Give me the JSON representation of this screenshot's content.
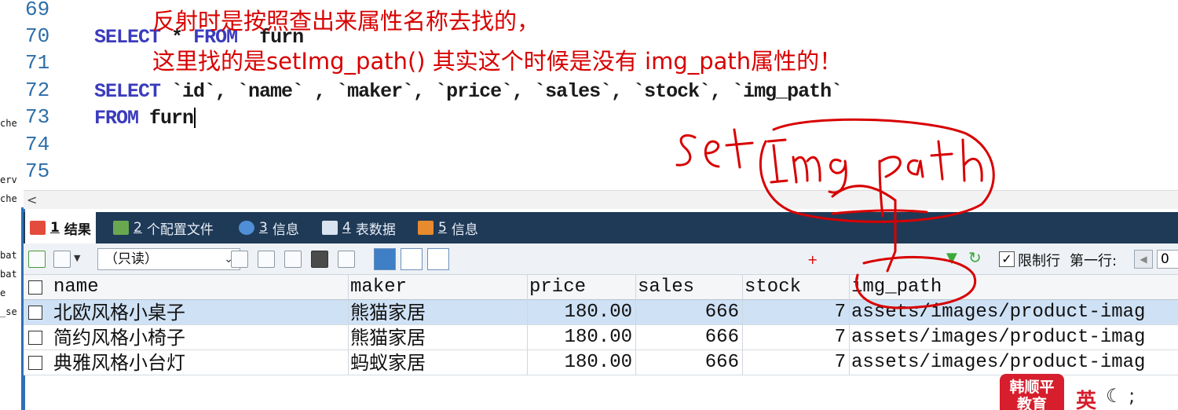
{
  "sidebar_fragments": [
    "che",
    "erv",
    "che",
    "bat",
    "bat",
    "e",
    "_se"
  ],
  "editor": {
    "line_numbers": [
      "69",
      "70",
      "71",
      "72",
      "73",
      "74",
      "75"
    ],
    "line70": {
      "kw1": "SELECT",
      "star": "*",
      "kw2": "FROM",
      "table": "furn"
    },
    "line72": {
      "kw": "SELECT",
      "cols": "`id`, `name` , `maker`, `price`, `sales`, `stock`, `img_path`"
    },
    "line73": {
      "kw": "FROM",
      "table": "furn"
    }
  },
  "annotation": {
    "line1": "反射时是按照查出来属性名称去找的，",
    "line2": "这里找的是setImg_path() 其实这个时候是没有 img_path属性的！",
    "handwriting": "setImg_path",
    "plus_mark": "+"
  },
  "hscroll": {
    "left_arrow": "<"
  },
  "tabs": [
    {
      "num": "1",
      "label": "结果",
      "active": true
    },
    {
      "num": "2",
      "label": "个配置文件",
      "active": false
    },
    {
      "num": "3",
      "label": "信息",
      "active": false
    },
    {
      "num": "4",
      "label": "表数据",
      "active": false
    },
    {
      "num": "5",
      "label": "信息",
      "active": false
    }
  ],
  "toolbar": {
    "readonly_option": "（只读）",
    "limit_rows_label": "限制行",
    "limit_checked": "✓",
    "first_row_label": "第一行:",
    "first_row_value": "0"
  },
  "grid": {
    "columns": [
      "name",
      "maker",
      "price",
      "sales",
      "stock",
      "img_path"
    ],
    "rows": [
      {
        "name": "北欧风格小桌子",
        "maker": "熊猫家居",
        "price": "180.00",
        "sales": "666",
        "stock": "7",
        "img_path": "assets/images/product-imag",
        "selected": true
      },
      {
        "name": "简约风格小椅子",
        "maker": "熊猫家居",
        "price": "180.00",
        "sales": "666",
        "stock": "7",
        "img_path": "assets/images/product-imag",
        "selected": false
      },
      {
        "name": "典雅风格小台灯",
        "maker": "蚂蚁家居",
        "price": "180.00",
        "sales": "666",
        "stock": "7",
        "img_path": "assets/images/product-imag",
        "selected": false
      }
    ]
  },
  "watermark": {
    "logo_line1": "韩顺平",
    "logo_line2": "教育",
    "ime": "英"
  },
  "colors": {
    "annotation_red": "#d80000",
    "keyword_blue": "#3b3bbe",
    "tab_bar": "#1f3a57",
    "selected_row": "#cfe1f5"
  }
}
